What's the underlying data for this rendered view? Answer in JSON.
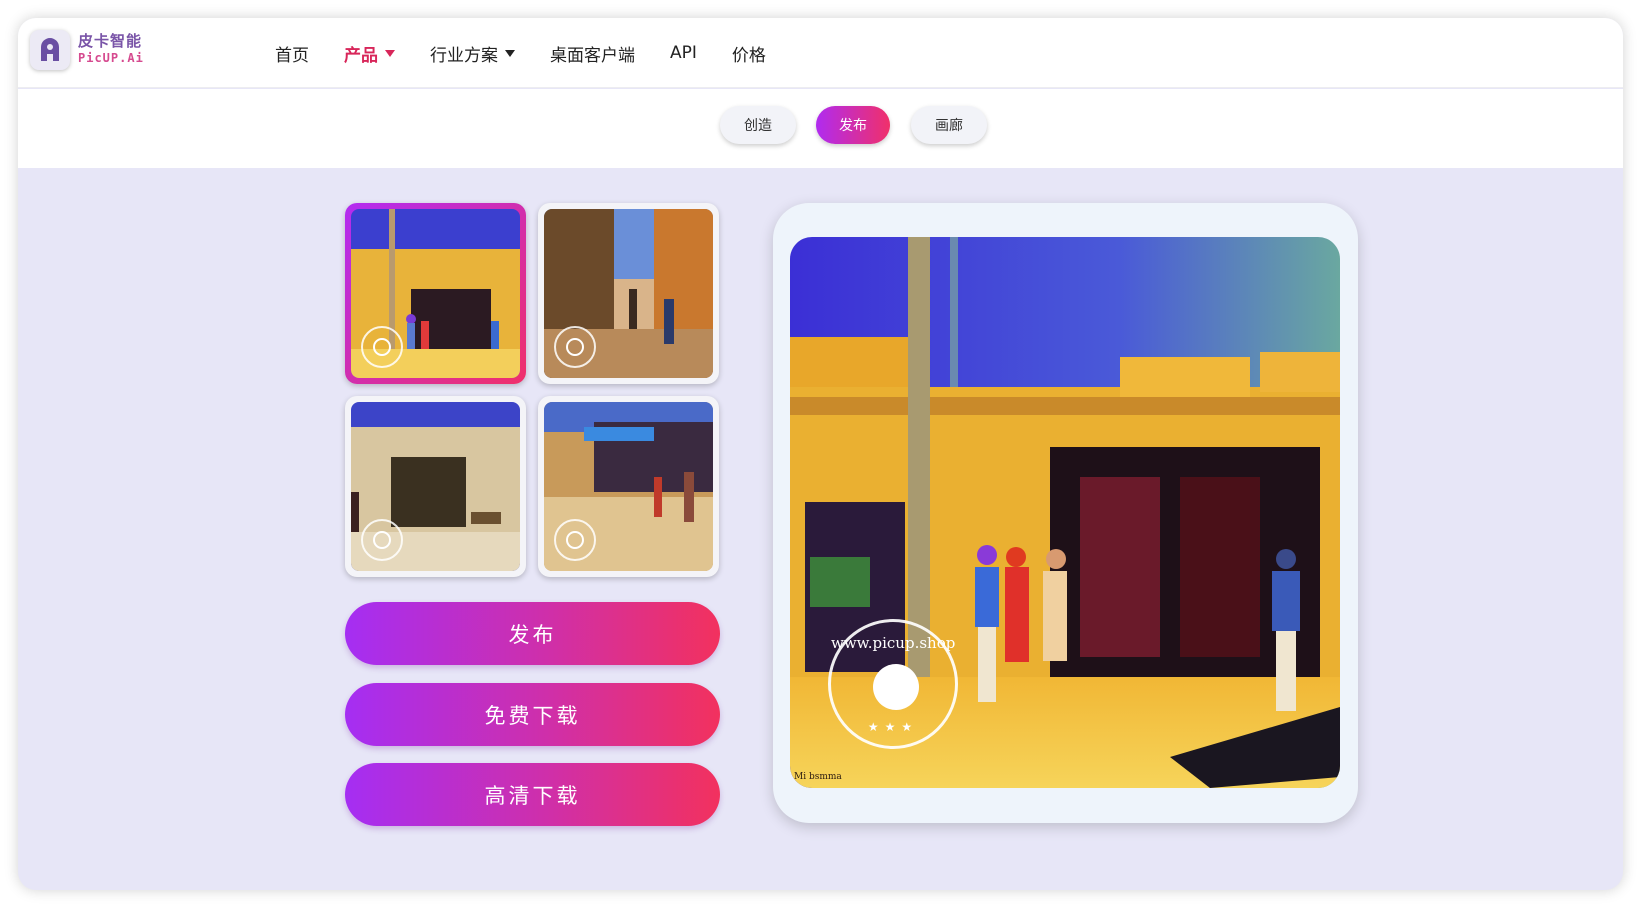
{
  "logo": {
    "cn": "皮卡智能",
    "en": "PicUP.Ai"
  },
  "nav": {
    "items": [
      {
        "label": "首页"
      },
      {
        "label": "产品"
      },
      {
        "label": "行业方案"
      },
      {
        "label": "桌面客户端"
      },
      {
        "label": "API"
      },
      {
        "label": "价格"
      }
    ]
  },
  "subtabs": {
    "create": "创造",
    "publish": "发布",
    "gallery": "画廊"
  },
  "actions": {
    "publish": "发布",
    "free_download": "免费下载",
    "hd_download": "高清下载"
  },
  "preview": {
    "watermark": "www.picup.shop",
    "signature": "Mi bsmma"
  },
  "colors": {
    "accent_start": "#a52ef3",
    "accent_end": "#f2315e",
    "nav_active": "#d8265a"
  },
  "thumbnails": {
    "selected_index": 0,
    "count": 4
  }
}
